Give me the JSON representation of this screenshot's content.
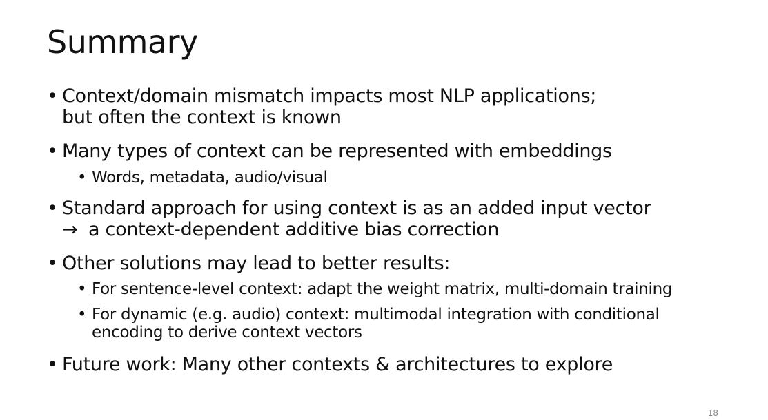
{
  "slide": {
    "title": "Summary",
    "bullet_glyph": "•",
    "arrow_glyph": "→",
    "page_number": "18",
    "items": [
      {
        "lines": [
          "Context/domain mismatch impacts most NLP applications;",
          "but often the context is known"
        ]
      },
      {
        "lines": [
          "Many types of context can be represented with embeddings"
        ]
      },
      {
        "lines": [
          "Words, metadata, audio/visual"
        ]
      },
      {
        "lines": [
          "Standard approach for using context is as an added input vector",
          "a context-dependent additive bias correction"
        ]
      },
      {
        "lines": [
          "Other solutions may lead to better results:"
        ]
      },
      {
        "lines": [
          "For sentence-level context: adapt the weight matrix, multi-domain training"
        ]
      },
      {
        "lines": [
          "For dynamic (e.g. audio) context: multimodal integration with conditional",
          "encoding to derive context vectors"
        ]
      },
      {
        "lines": [
          "Future work: Many other contexts & architectures to explore"
        ]
      }
    ]
  }
}
